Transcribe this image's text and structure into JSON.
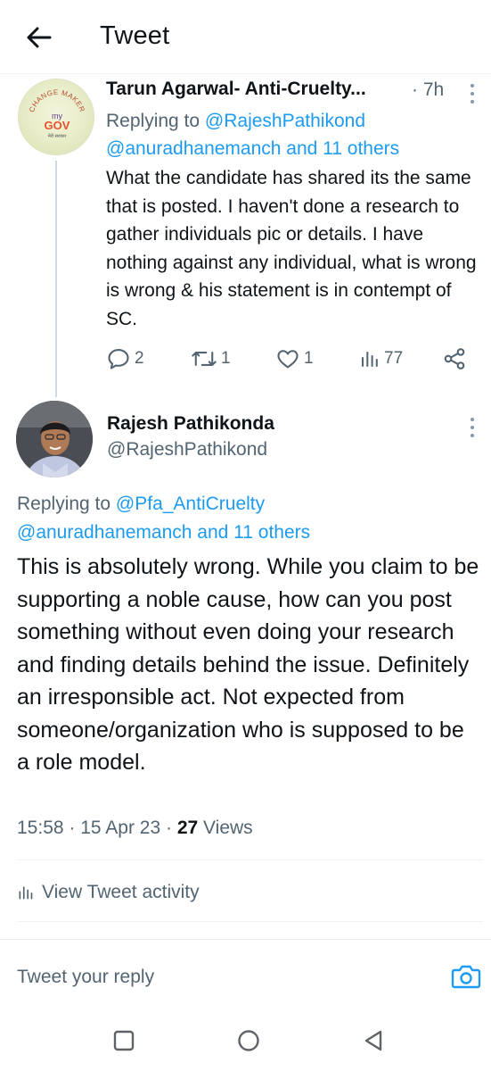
{
  "header": {
    "title": "Tweet",
    "back_icon": "arrow-left-icon"
  },
  "parent_tweet": {
    "avatar_logo_text": "CHANGE MAKER · myGov · मेरी सरकार",
    "author_name": "Tarun Agarwal- Anti-Cruelty...",
    "time_sep": "·",
    "time": "7h",
    "replying_prefix": "Replying to",
    "replying_handle": "@RajeshPathikond",
    "replying_others": "@anuradhanemanch and 11 others",
    "text": "What the candidate has shared its the same that is posted. I haven't done a research to gather individuals pic or details. I have nothing against any individual,  what is wrong is wrong & his statement  is in contempt of SC.",
    "actions": {
      "replies": "2",
      "retweets": "1",
      "likes": "1",
      "views": "77"
    }
  },
  "main_tweet": {
    "author_name": "Rajesh Pathikonda",
    "author_handle": "@RajeshPathikond",
    "replying_prefix": "Replying to",
    "replying_handle": "@Pfa_AntiCruelty",
    "replying_others": "@anuradhanemanch and 11 others",
    "text": "This is absolutely wrong. While you claim to be supporting a noble cause, how can you post something without even doing your research and finding details behind the issue. Definitely an irresponsible act. Not expected from someone/organization who is supposed to be a role model.",
    "time": "15:58",
    "sep": "·",
    "date": "15 Apr 23",
    "views_count": "27",
    "views_label": "Views"
  },
  "activity": {
    "label": "View Tweet activity"
  },
  "reply_box": {
    "placeholder": "Tweet your reply"
  },
  "colors": {
    "accent": "#1d9bf0",
    "muted": "#536471",
    "text": "#0f1419"
  },
  "android_nav": [
    "square-recents-icon",
    "circle-home-icon",
    "triangle-back-icon"
  ]
}
